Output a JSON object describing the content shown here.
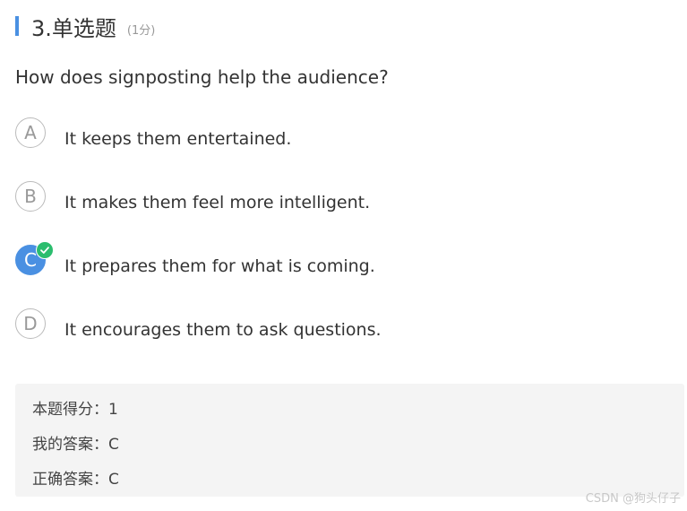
{
  "header": {
    "title": "3.单选题",
    "score": "(1分)"
  },
  "question": {
    "text": "How does signposting help the audience?"
  },
  "options": [
    {
      "letter": "A",
      "text": "It keeps them entertained.",
      "selected": false
    },
    {
      "letter": "B",
      "text": "It makes them feel more intelligent.",
      "selected": false
    },
    {
      "letter": "C",
      "text": "It prepares them for what is coming.",
      "selected": true,
      "badge_icon": "check-icon"
    },
    {
      "letter": "D",
      "text": "It encourages them to ask questions.",
      "selected": false
    }
  ],
  "result": {
    "score_line": "本题得分：1",
    "my_answer_line": "我的答案：C",
    "correct_answer_line": "正确答案：C"
  },
  "watermark": "CSDN @狗头仔子",
  "colors": {
    "accent": "#4a90e2",
    "correct": "#2bbd6e",
    "panel": "#f4f4f4"
  }
}
